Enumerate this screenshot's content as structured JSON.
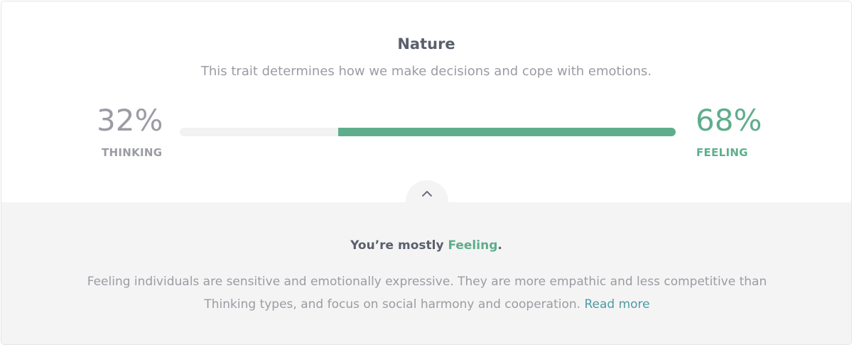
{
  "trait": {
    "title": "Nature",
    "description": "This trait determines how we make decisions and cope with emotions."
  },
  "scale": {
    "left": {
      "percent_label": "32%",
      "label": "THINKING",
      "value": 32
    },
    "right": {
      "percent_label": "68%",
      "label": "FEELING",
      "value": 68
    }
  },
  "toggle": {
    "icon": "chevron-up-icon"
  },
  "summary": {
    "prefix": "You’re mostly ",
    "trait": "Feeling",
    "suffix": "."
  },
  "explanation": {
    "text": "Feeling individuals are sensitive and emotionally expressive. They are more empathic and less competitive than Thinking types, and focus on social harmony and cooperation. ",
    "link_label": "Read more"
  },
  "colors": {
    "accent": "#5eae8b",
    "muted": "#9b9ca3",
    "link": "#4e9aa4",
    "panel": "#f4f4f4"
  }
}
